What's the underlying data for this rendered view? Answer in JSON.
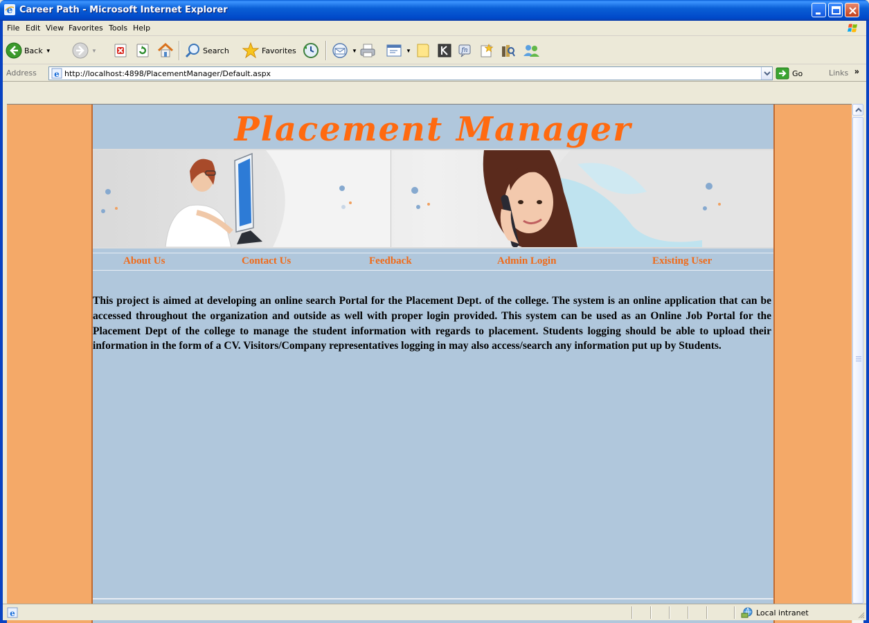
{
  "window": {
    "title": "Career Path - Microsoft Internet Explorer"
  },
  "menu": {
    "items": [
      {
        "label": "File"
      },
      {
        "label": "Edit"
      },
      {
        "label": "View"
      },
      {
        "label": "Favorites"
      },
      {
        "label": "Tools"
      },
      {
        "label": "Help"
      }
    ]
  },
  "toolbar": {
    "back_label": "Back",
    "search_label": "Search",
    "favorites_label": "Favorites"
  },
  "address": {
    "label": "Address",
    "url": "http://localhost:4898/PlacementManager/Default.aspx",
    "go_label": "Go",
    "links_label": "Links"
  },
  "page": {
    "title": "Placement Manager",
    "nav": [
      {
        "label": "About Us"
      },
      {
        "label": "Contact Us"
      },
      {
        "label": "Feedback"
      },
      {
        "label": "Admin Login"
      },
      {
        "label": "Existing User"
      }
    ],
    "intro": "This project is aimed at developing an online search Portal for the Placement Dept. of the college. The system is an online application that can be accessed throughout the organization and outside as well with proper login provided. This system can be used as an Online Job Portal for the Placement Dept of the college to manage the student information with regards to placement. Students logging should be able to upload their information in the form of a CV. Visitors/Company representatives logging in may also access/search any information put up by Students."
  },
  "status": {
    "zone": "Local intranet"
  },
  "colors": {
    "page_background": "#f4a968",
    "content_background": "#b0c7dc",
    "title_color": "#ff6a10",
    "nav_link_color": "#f06a18"
  }
}
